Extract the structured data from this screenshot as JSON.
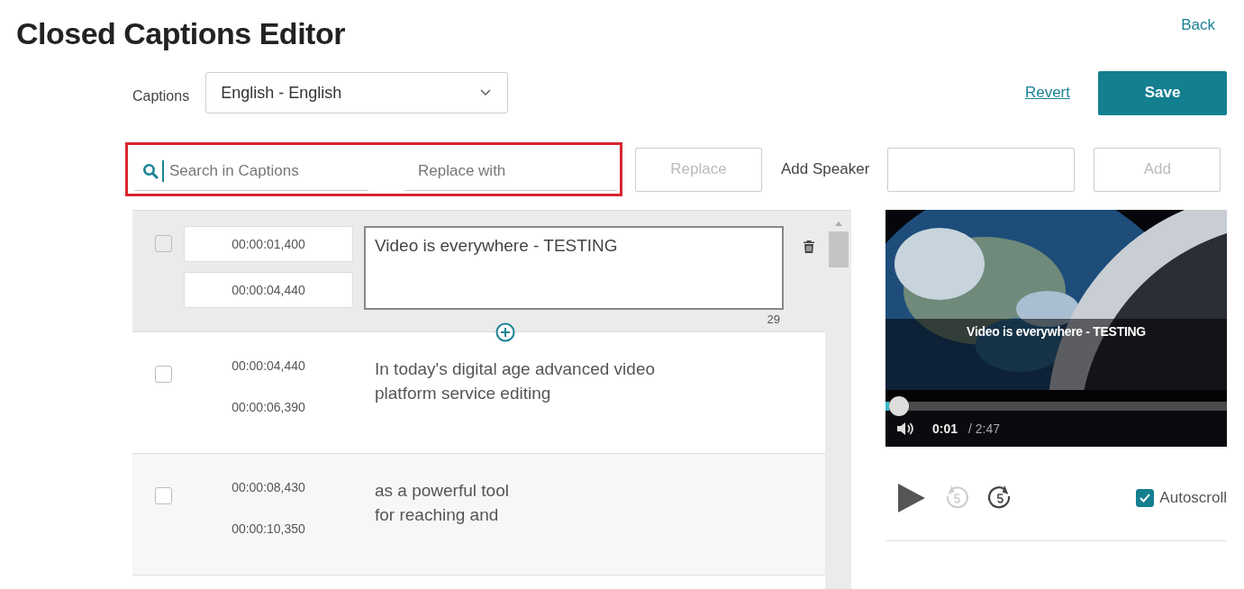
{
  "title": "Closed Captions Editor",
  "back_link": "Back",
  "captions": {
    "label": "Captions",
    "value": "English - English"
  },
  "revert_link": "Revert",
  "save_button": "Save",
  "search": {
    "placeholder": "Search in Captions",
    "highlighted": true
  },
  "replace": {
    "placeholder": "Replace with"
  },
  "replace_button": {
    "label": "Replace",
    "disabled": true
  },
  "add_speaker": {
    "label": "Add Speaker",
    "button": "Add",
    "disabled": true
  },
  "rows": [
    {
      "editing": true,
      "checked": false,
      "start": "00:00:01,400",
      "end": "00:00:04,440",
      "lines": [
        "Video is everywhere - TESTING"
      ],
      "count": "29"
    },
    {
      "editing": false,
      "checked": false,
      "start": "00:00:04,440",
      "end": "00:00:06,390",
      "lines": [
        "In today's digital age advanced video",
        "platform service editing"
      ]
    },
    {
      "editing": false,
      "checked": false,
      "start": "00:00:08,430",
      "end": "00:00:10,350",
      "lines": [
        "as a powerful tool",
        "for reaching and"
      ]
    }
  ],
  "video": {
    "subtitle": "Video is everywhere - TESTING",
    "level": 0.01,
    "current": "0:01",
    "duration": "/ 2:47"
  },
  "autoscroll": {
    "label": "Autoscroll",
    "checked": true
  }
}
